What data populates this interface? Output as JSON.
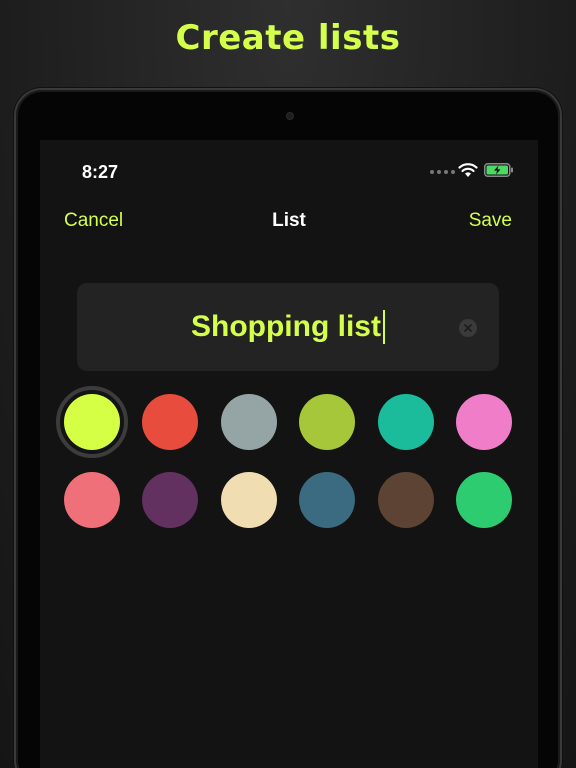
{
  "headline": "Create lists",
  "status_bar": {
    "time": "8:27"
  },
  "nav": {
    "cancel_label": "Cancel",
    "title": "List",
    "save_label": "Save"
  },
  "list_name": {
    "value": "Shopping list"
  },
  "palette": {
    "selected_index": 0,
    "colors": [
      "#d4ff45",
      "#e84c3d",
      "#95a5a6",
      "#a5c739",
      "#1abc9c",
      "#f07dc8",
      "#f0707a",
      "#62315f",
      "#f0ddb2",
      "#3a6b80",
      "#5d4333",
      "#2ecc71"
    ]
  },
  "colors": {
    "accent": "#d4ff4a",
    "background": "#131313",
    "field": "#232323"
  }
}
